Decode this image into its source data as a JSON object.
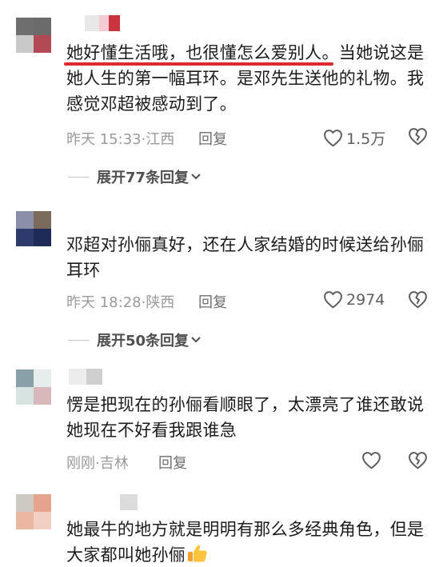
{
  "comments": [
    {
      "text": "她好懂生活哦，也很懂怎么爱别人。当她说这是她人生的第一幅耳环。是邓先生送他的礼物。我感觉邓超被感动到了。",
      "time": "昨天 15:33",
      "location": "江西",
      "reply_label": "回复",
      "likes": "1.5万",
      "expand_label": "展开77条回复",
      "avatar_colors": [
        "#6e6e6e",
        "#6b6b6b",
        "#c9c9c9",
        "#b24a55"
      ],
      "name_colors": [
        "#e8e8e8",
        "#f3cbd0",
        "#c9343e"
      ]
    },
    {
      "text": "邓超对孙俪真好，还在人家结婚的时候送给孙俪耳环",
      "time": "昨天 18:28",
      "location": "陕西",
      "reply_label": "回复",
      "likes": "2974",
      "expand_label": "展开50条回复",
      "avatar_colors": [
        "#8c8fa8",
        "#7a6b5c",
        "#2e3a6b",
        "#1e2a58"
      ],
      "name_colors": []
    },
    {
      "text": "愣是把现在的孙俪看顺眼了，太漂亮了谁还敢说她现在不好看我跟谁急",
      "time": "刚刚",
      "location": "吉林",
      "reply_label": "回复",
      "likes": "",
      "avatar_colors": [
        "#8aa0a8",
        "#e7ecec",
        "#d7e3e0",
        "#d8b8ba"
      ],
      "name_colors": [
        "#ececec",
        "#cfcfcf"
      ]
    },
    {
      "text": "她最牛的地方就是明明有那么多经典角色，但是大家都叫她孙俪",
      "avatar_colors": [
        "#cfc9c3",
        "#e4a38a",
        "#e9b7a2",
        "#f2cfc3"
      ],
      "name_colors": [
        "#dcdcdc"
      ]
    }
  ],
  "icons": {
    "like": "heart-outline-icon",
    "dislike": "broken-heart-icon",
    "expand": "chevron-down-icon",
    "emoji": "thumbs-up-emoji"
  },
  "colors": {
    "highlight_underline": "#e0282e",
    "text": "#1b1b1b",
    "meta": "#9a9a9a"
  }
}
